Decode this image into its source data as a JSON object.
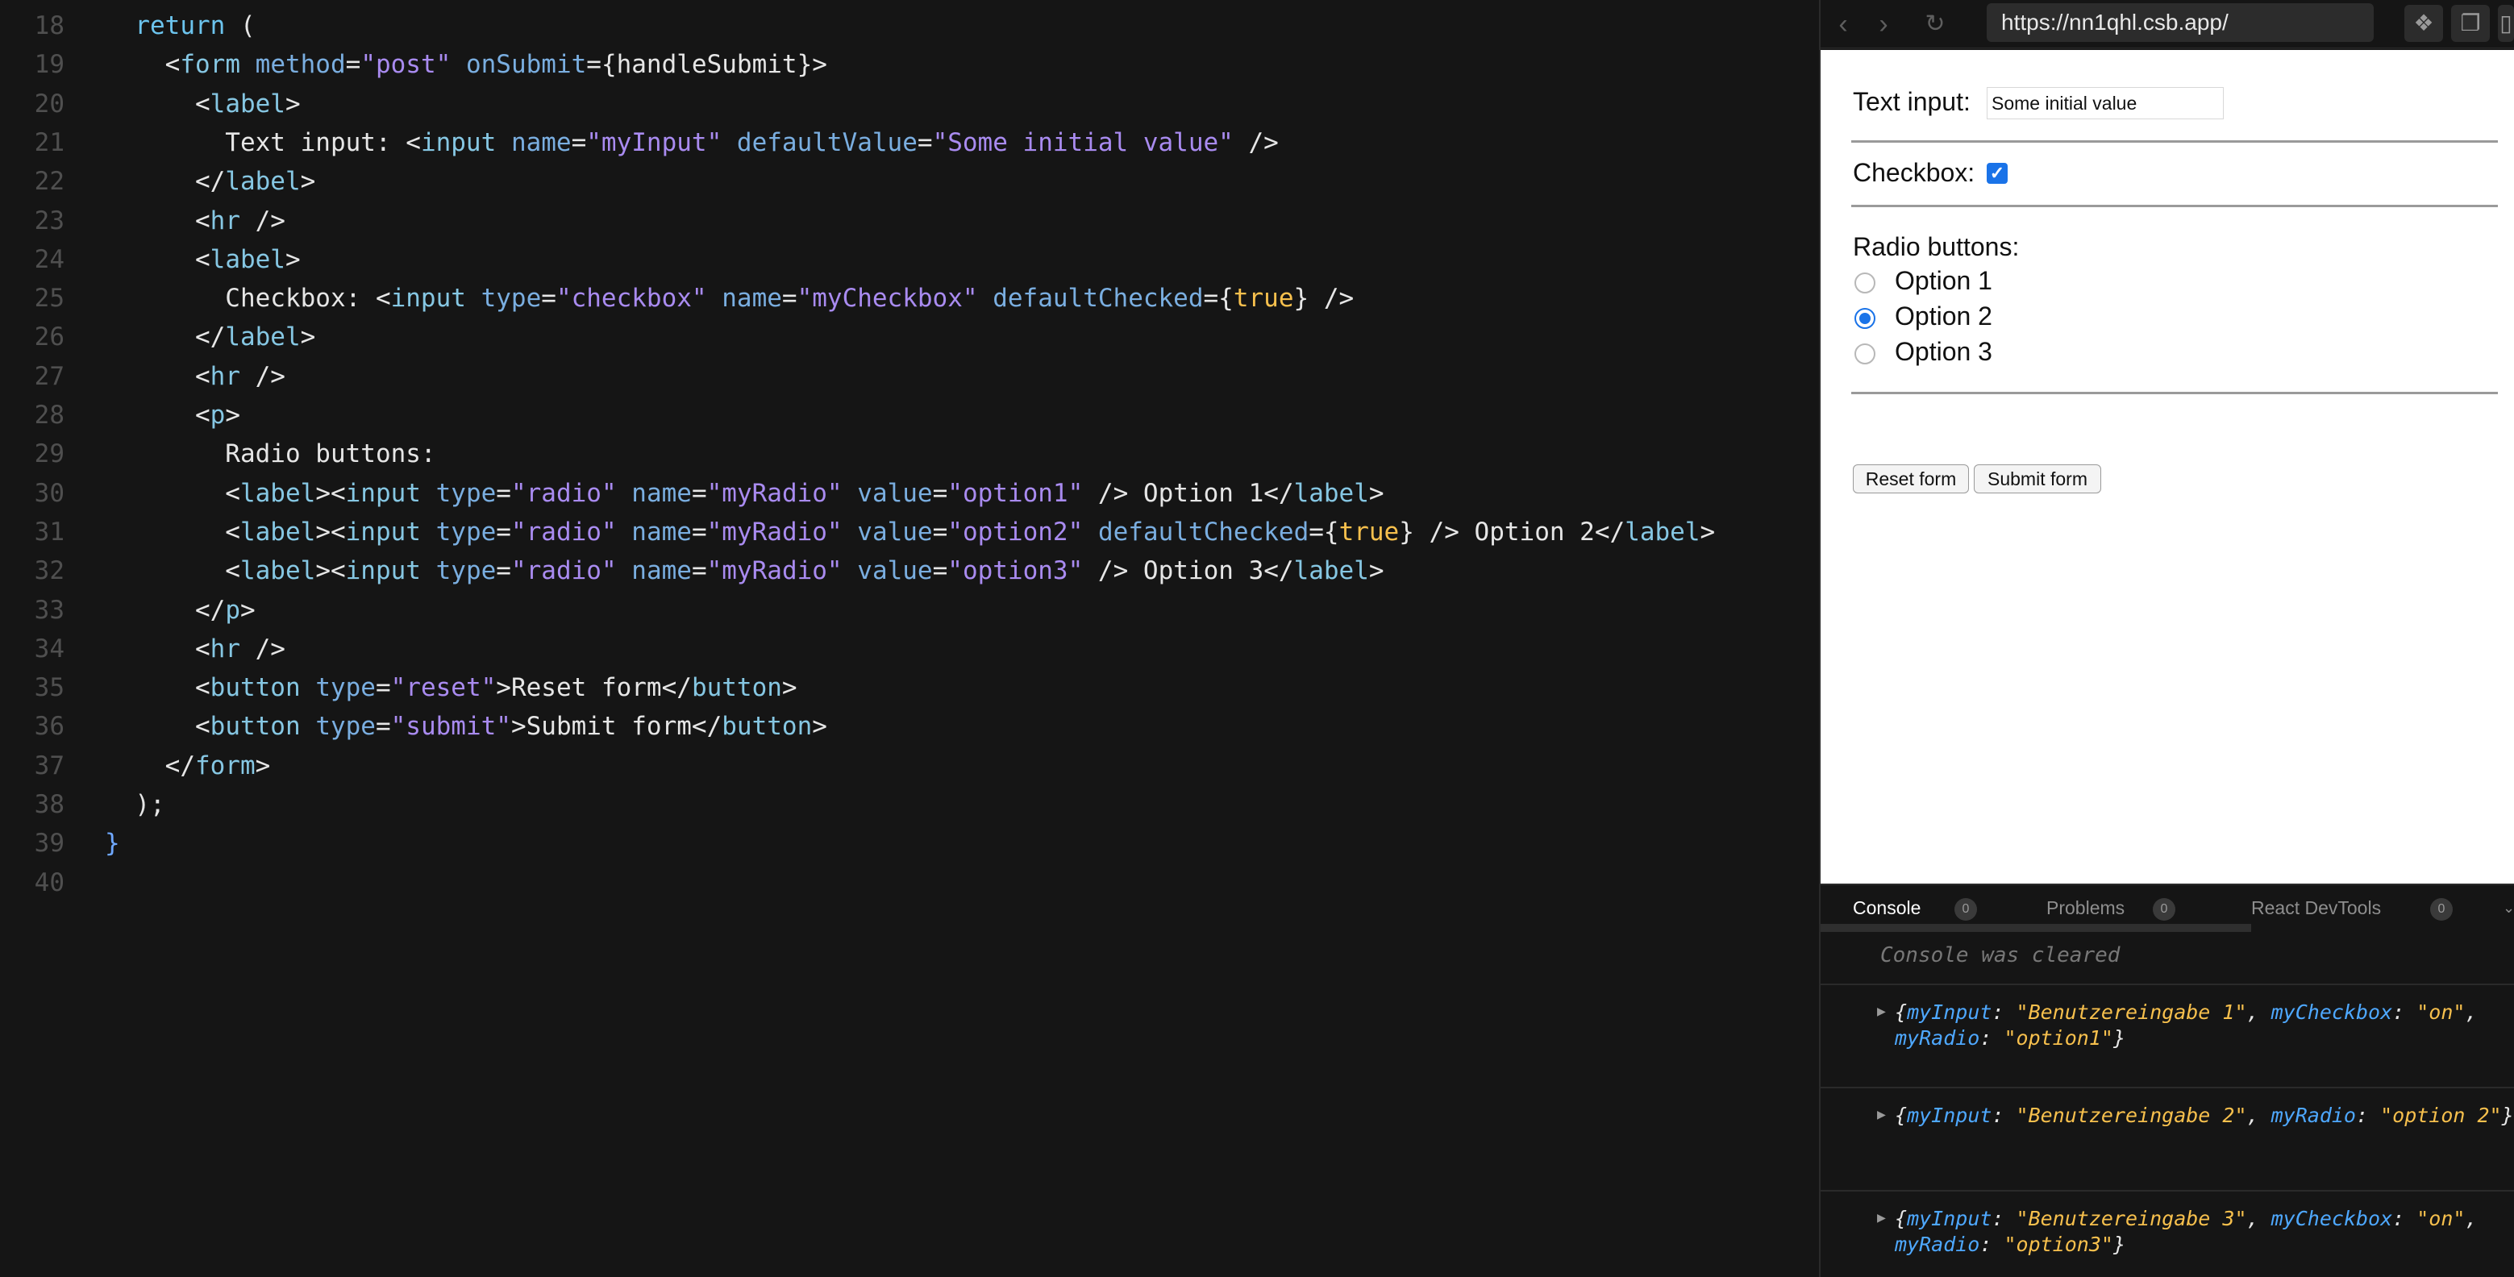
{
  "editor": {
    "lines": [
      {
        "no": "18",
        "tokens": [
          {
            "t": "  "
          },
          {
            "t": "return",
            "c": "kw"
          },
          {
            "t": " ("
          }
        ]
      },
      {
        "no": "19",
        "tokens": [
          {
            "t": "    <"
          },
          {
            "t": "form",
            "c": "tag"
          },
          {
            "t": " "
          },
          {
            "t": "method",
            "c": "attr"
          },
          {
            "t": "="
          },
          {
            "t": "\"post\"",
            "c": "str"
          },
          {
            "t": " "
          },
          {
            "t": "onSubmit",
            "c": "attr"
          },
          {
            "t": "={handleSubmit}>"
          }
        ]
      },
      {
        "no": "20",
        "tokens": [
          {
            "t": "      <"
          },
          {
            "t": "label",
            "c": "tag"
          },
          {
            "t": ">"
          }
        ]
      },
      {
        "no": "21",
        "tokens": [
          {
            "t": "        Text input: <"
          },
          {
            "t": "input",
            "c": "tag"
          },
          {
            "t": " "
          },
          {
            "t": "name",
            "c": "attr"
          },
          {
            "t": "="
          },
          {
            "t": "\"myInput\"",
            "c": "str"
          },
          {
            "t": " "
          },
          {
            "t": "defaultValue",
            "c": "attr"
          },
          {
            "t": "="
          },
          {
            "t": "\"Some initial value\"",
            "c": "str"
          },
          {
            "t": " />"
          }
        ]
      },
      {
        "no": "22",
        "tokens": [
          {
            "t": "      </"
          },
          {
            "t": "label",
            "c": "tag"
          },
          {
            "t": ">"
          }
        ]
      },
      {
        "no": "23",
        "tokens": [
          {
            "t": "      <"
          },
          {
            "t": "hr",
            "c": "tag"
          },
          {
            "t": " />"
          }
        ]
      },
      {
        "no": "24",
        "tokens": [
          {
            "t": "      <"
          },
          {
            "t": "label",
            "c": "tag"
          },
          {
            "t": ">"
          }
        ]
      },
      {
        "no": "25",
        "tokens": [
          {
            "t": "        Checkbox: <"
          },
          {
            "t": "input",
            "c": "tag"
          },
          {
            "t": " "
          },
          {
            "t": "type",
            "c": "attr"
          },
          {
            "t": "="
          },
          {
            "t": "\"checkbox\"",
            "c": "str"
          },
          {
            "t": " "
          },
          {
            "t": "name",
            "c": "attr"
          },
          {
            "t": "="
          },
          {
            "t": "\"myCheckbox\"",
            "c": "str"
          },
          {
            "t": " "
          },
          {
            "t": "defaultChecked",
            "c": "attr"
          },
          {
            "t": "={"
          },
          {
            "t": "true",
            "c": "num"
          },
          {
            "t": "} />"
          }
        ]
      },
      {
        "no": "26",
        "tokens": [
          {
            "t": "      </"
          },
          {
            "t": "label",
            "c": "tag"
          },
          {
            "t": ">"
          }
        ]
      },
      {
        "no": "27",
        "tokens": [
          {
            "t": "      <"
          },
          {
            "t": "hr",
            "c": "tag"
          },
          {
            "t": " />"
          }
        ]
      },
      {
        "no": "28",
        "tokens": [
          {
            "t": "      <"
          },
          {
            "t": "p",
            "c": "tag"
          },
          {
            "t": ">"
          }
        ]
      },
      {
        "no": "29",
        "tokens": [
          {
            "t": "        Radio buttons:"
          }
        ]
      },
      {
        "no": "30",
        "tokens": [
          {
            "t": "        <"
          },
          {
            "t": "label",
            "c": "tag"
          },
          {
            "t": "><"
          },
          {
            "t": "input",
            "c": "tag"
          },
          {
            "t": " "
          },
          {
            "t": "type",
            "c": "attr"
          },
          {
            "t": "="
          },
          {
            "t": "\"radio\"",
            "c": "str"
          },
          {
            "t": " "
          },
          {
            "t": "name",
            "c": "attr"
          },
          {
            "t": "="
          },
          {
            "t": "\"myRadio\"",
            "c": "str"
          },
          {
            "t": " "
          },
          {
            "t": "value",
            "c": "attr"
          },
          {
            "t": "="
          },
          {
            "t": "\"option1\"",
            "c": "str"
          },
          {
            "t": " /> Option 1</"
          },
          {
            "t": "label",
            "c": "tag"
          },
          {
            "t": ">"
          }
        ]
      },
      {
        "no": "31",
        "tokens": [
          {
            "t": "        <"
          },
          {
            "t": "label",
            "c": "tag"
          },
          {
            "t": "><"
          },
          {
            "t": "input",
            "c": "tag"
          },
          {
            "t": " "
          },
          {
            "t": "type",
            "c": "attr"
          },
          {
            "t": "="
          },
          {
            "t": "\"radio\"",
            "c": "str"
          },
          {
            "t": " "
          },
          {
            "t": "name",
            "c": "attr"
          },
          {
            "t": "="
          },
          {
            "t": "\"myRadio\"",
            "c": "str"
          },
          {
            "t": " "
          },
          {
            "t": "value",
            "c": "attr"
          },
          {
            "t": "="
          },
          {
            "t": "\"option2\"",
            "c": "str"
          },
          {
            "t": " "
          },
          {
            "t": "defaultChecked",
            "c": "attr"
          },
          {
            "t": "={"
          },
          {
            "t": "true",
            "c": "num"
          },
          {
            "t": "} /> Option 2</"
          },
          {
            "t": "label",
            "c": "tag"
          },
          {
            "t": ">"
          }
        ]
      },
      {
        "no": "32",
        "tokens": [
          {
            "t": "        <"
          },
          {
            "t": "label",
            "c": "tag"
          },
          {
            "t": "><"
          },
          {
            "t": "input",
            "c": "tag"
          },
          {
            "t": " "
          },
          {
            "t": "type",
            "c": "attr"
          },
          {
            "t": "="
          },
          {
            "t": "\"radio\"",
            "c": "str"
          },
          {
            "t": " "
          },
          {
            "t": "name",
            "c": "attr"
          },
          {
            "t": "="
          },
          {
            "t": "\"myRadio\"",
            "c": "str"
          },
          {
            "t": " "
          },
          {
            "t": "value",
            "c": "attr"
          },
          {
            "t": "="
          },
          {
            "t": "\"option3\"",
            "c": "str"
          },
          {
            "t": " /> Option 3</"
          },
          {
            "t": "label",
            "c": "tag"
          },
          {
            "t": ">"
          }
        ]
      },
      {
        "no": "33",
        "tokens": [
          {
            "t": "      </"
          },
          {
            "t": "p",
            "c": "tag"
          },
          {
            "t": ">"
          }
        ]
      },
      {
        "no": "34",
        "tokens": [
          {
            "t": "      <"
          },
          {
            "t": "hr",
            "c": "tag"
          },
          {
            "t": " />"
          }
        ]
      },
      {
        "no": "35",
        "tokens": [
          {
            "t": "      <"
          },
          {
            "t": "button",
            "c": "tag"
          },
          {
            "t": " "
          },
          {
            "t": "type",
            "c": "attr"
          },
          {
            "t": "="
          },
          {
            "t": "\"reset\"",
            "c": "str"
          },
          {
            "t": ">Reset form</"
          },
          {
            "t": "button",
            "c": "tag"
          },
          {
            "t": ">"
          }
        ]
      },
      {
        "no": "36",
        "tokens": [
          {
            "t": "      <"
          },
          {
            "t": "button",
            "c": "tag"
          },
          {
            "t": " "
          },
          {
            "t": "type",
            "c": "attr"
          },
          {
            "t": "="
          },
          {
            "t": "\"submit\"",
            "c": "str"
          },
          {
            "t": ">Submit form</"
          },
          {
            "t": "button",
            "c": "tag"
          },
          {
            "t": ">"
          }
        ]
      },
      {
        "no": "37",
        "tokens": [
          {
            "t": "    </"
          },
          {
            "t": "form",
            "c": "tag"
          },
          {
            "t": ">"
          }
        ]
      },
      {
        "no": "38",
        "tokens": [
          {
            "t": "  );"
          }
        ]
      },
      {
        "no": "39",
        "tokens": [
          {
            "t": "}",
            "c": "brace"
          }
        ]
      },
      {
        "no": "40",
        "tokens": []
      }
    ]
  },
  "browser": {
    "back_icon": "chevron-left-icon",
    "forward_icon": "chevron-right-icon",
    "reload_icon": "reload-icon",
    "url": "https://nn1qhl.csb.app/",
    "tool_icons": [
      "devtools-icon",
      "open-window-icon",
      "split-icon"
    ]
  },
  "preview": {
    "text_input_label": "Text input:",
    "text_input_value": "Some initial value",
    "checkbox_label": "Checkbox:",
    "checkbox_checked": true,
    "radio_heading": "Radio buttons:",
    "radio_options": [
      {
        "label": "Option 1",
        "checked": false
      },
      {
        "label": "Option 2",
        "checked": true
      },
      {
        "label": "Option 3",
        "checked": false
      }
    ],
    "reset_label": "Reset form",
    "submit_label": "Submit form",
    "accent_color": "#1a73e8"
  },
  "devtools": {
    "tabs": [
      {
        "label": "Console",
        "count": "0",
        "active": true
      },
      {
        "label": "Problems",
        "count": "0",
        "active": false
      },
      {
        "label": "React DevTools",
        "count": "0",
        "active": false
      }
    ],
    "cleared_text": "Console was cleared",
    "logs": [
      [
        {
          "k": "myInput",
          "v": "\"Benutzereingabe 1\""
        },
        {
          "k": "myCheckbox",
          "v": "\"on\""
        },
        {
          "k": "myRadio",
          "v": "\"option1\""
        }
      ],
      [
        {
          "k": "myInput",
          "v": "\"Benutzereingabe 2\""
        },
        {
          "k": "myRadio",
          "v": "\"option 2\""
        }
      ],
      [
        {
          "k": "myInput",
          "v": "\"Benutzereingabe 3\""
        },
        {
          "k": "myCheckbox",
          "v": "\"on\""
        },
        {
          "k": "myRadio",
          "v": "\"option3\""
        }
      ]
    ]
  }
}
